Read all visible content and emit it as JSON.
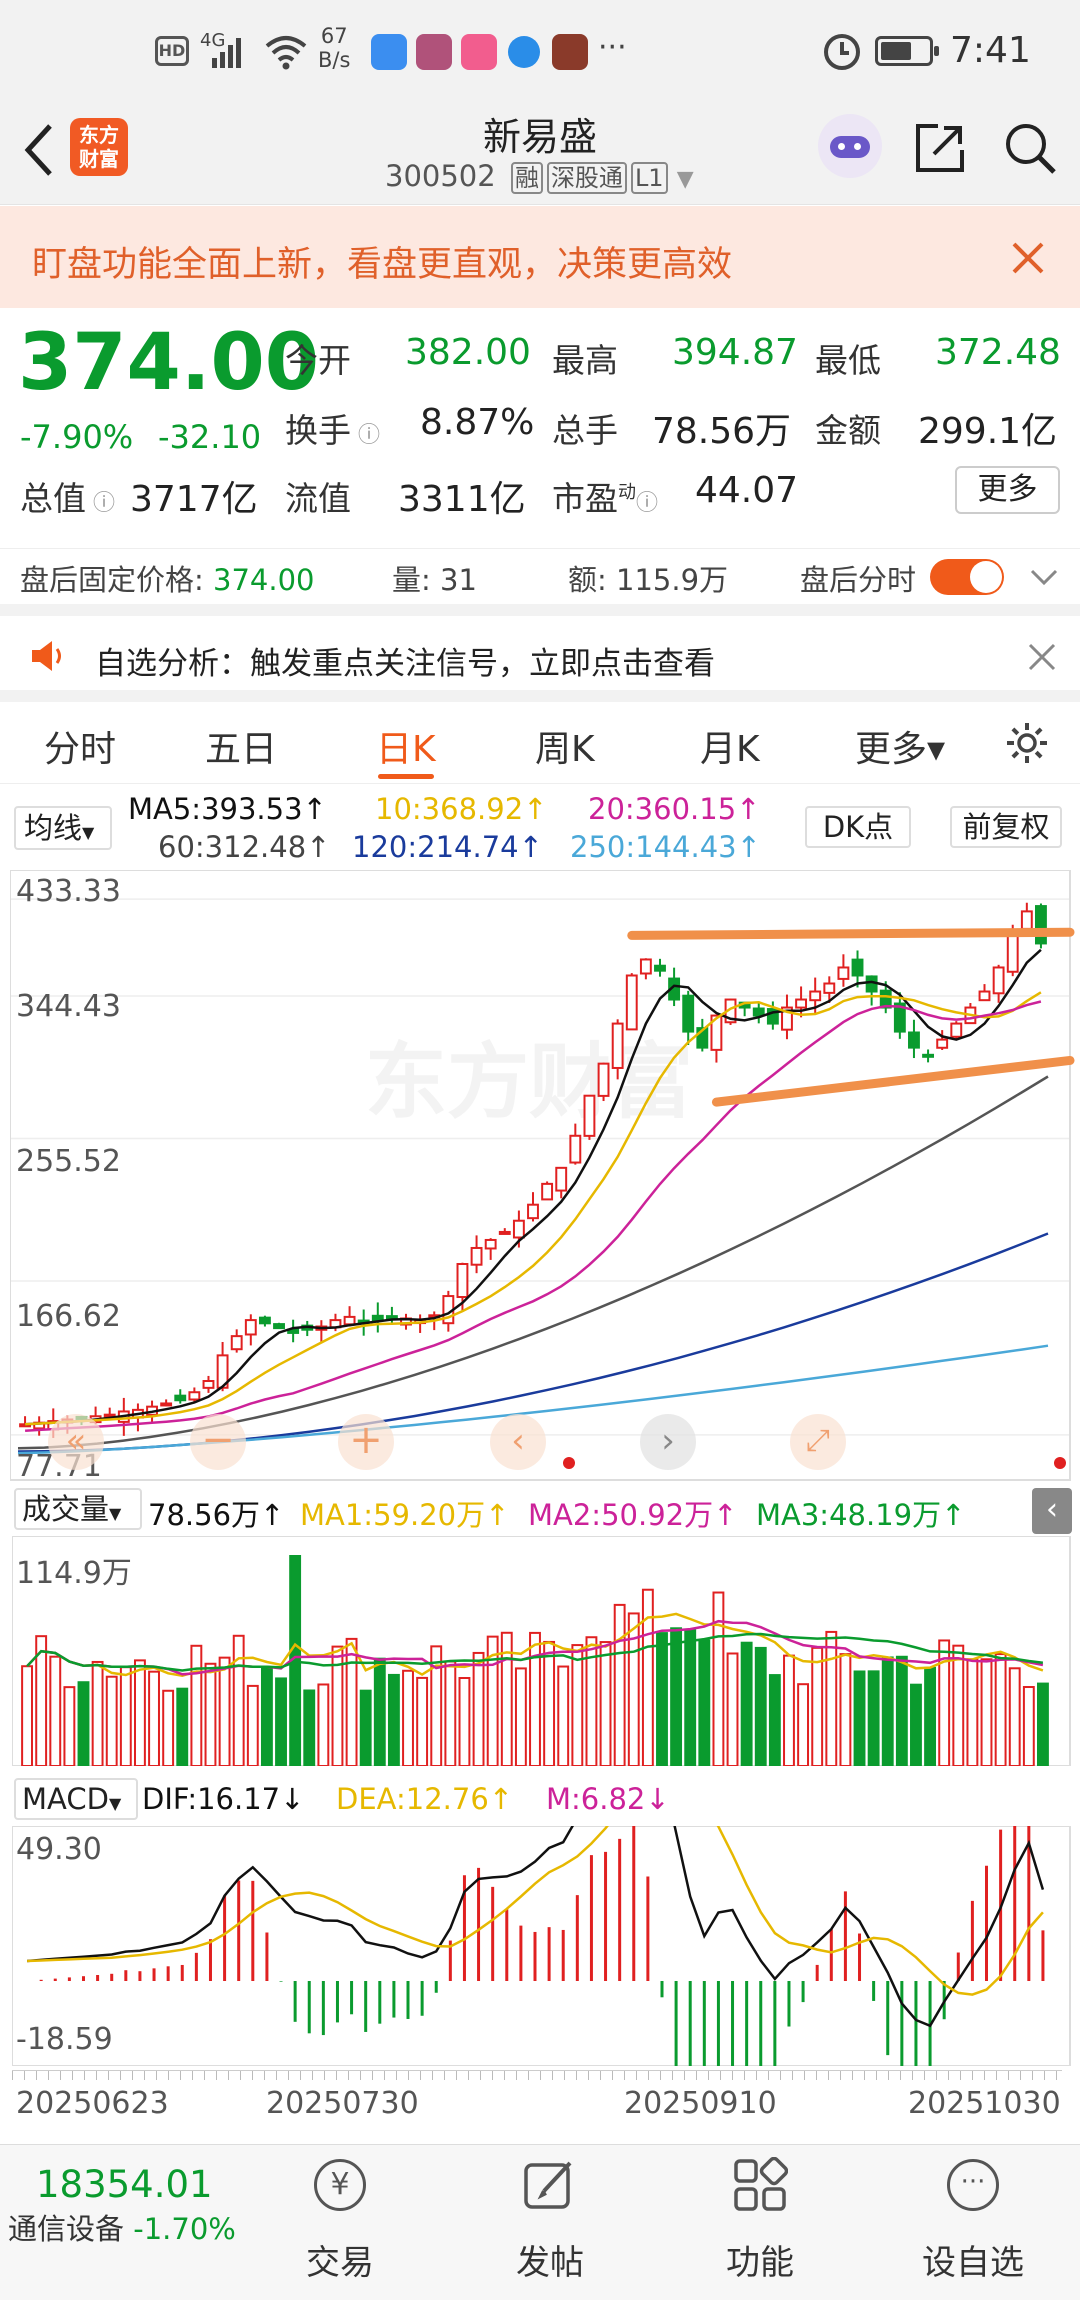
{
  "status_bar": {
    "signal": "4G",
    "net_speed_value": "67",
    "net_speed_unit": "B/s",
    "more": "···",
    "time": "7:41"
  },
  "header": {
    "logo_line1": "东方",
    "logo_line2": "财富",
    "stock_name": "新易盛",
    "stock_code": "300502",
    "tags": [
      "融",
      "深股通",
      "L1"
    ]
  },
  "banner": {
    "text": "盯盘功能全面上新，看盘更直观，决策更高效"
  },
  "quote": {
    "price": "374.00",
    "change_pct": "-7.90%",
    "change_amt": "-32.10",
    "open_label": "今开",
    "open": "382.00",
    "high_label": "最高",
    "high": "394.87",
    "low_label": "最低",
    "low": "372.48",
    "turnover_label": "换手",
    "turnover": "8.87%",
    "volume_label": "总手",
    "volume": "78.56万",
    "amount_label": "金额",
    "amount": "299.1亿",
    "mktcap_label": "总值",
    "mktcap": "3717亿",
    "float_label": "流值",
    "float_cap": "3311亿",
    "pe_label": "市盈",
    "pe_sup": "动",
    "pe": "44.07",
    "more_button": "更多"
  },
  "after_hours": {
    "price_label": "盘后固定价格:",
    "price": "374.00",
    "vol_label": "量:",
    "vol": "31",
    "amt_label": "额:",
    "amt": "115.9万",
    "toggle_label": "盘后分时"
  },
  "notice": {
    "text": "自选分析：触发重点关注信号，立即点击查看"
  },
  "tabs": {
    "items": [
      "分时",
      "五日",
      "日K",
      "周K",
      "月K",
      "更多▾"
    ],
    "active": "日K"
  },
  "ma_legend": {
    "selector": "均线",
    "ma5": "MA5:393.53↑",
    "ma10": "10:368.92↑",
    "ma20": "20:360.15↑",
    "ma60": "60:312.48↑",
    "ma120": "120:214.74↑",
    "ma250": "250:144.43↑",
    "dk_button": "DK点",
    "adjust_button": "前复权"
  },
  "colors": {
    "up": "#e02020",
    "down": "#0a9b2e",
    "ma5": "#111111",
    "ma10": "#e6b800",
    "ma20": "#cc2299",
    "ma60": "#555555",
    "ma120": "#1a3b9c",
    "ma250": "#4aa8d8",
    "trendline": "#f0904a",
    "accent": "#f05a1a"
  },
  "price_axis": [
    "433.33",
    "344.43",
    "255.52",
    "166.62",
    "77.71"
  ],
  "volume_legend": {
    "selector": "成交量",
    "vol": "78.56万↑",
    "ma1": "MA1:59.20万↑",
    "ma2": "MA2:50.92万↑",
    "ma3": "MA3:48.19万↑",
    "axis_max": "114.9万"
  },
  "macd_legend": {
    "selector": "MACD",
    "dif": "DIF:16.17↓",
    "dea": "DEA:12.76↑",
    "m": "M:6.82↓",
    "axis_max": "49.30",
    "axis_min": "-18.59"
  },
  "date_axis": [
    "20250623",
    "20250730",
    "20250910",
    "20251030"
  ],
  "watermark": "东方财富",
  "bottom_nav": {
    "index_value": "18354.01",
    "index_name": "通信设备",
    "index_change": "-1.70%",
    "items": [
      "交易",
      "发帖",
      "功能",
      "设自选"
    ]
  },
  "chart_data": {
    "type": "candlestick",
    "y_range": [
      77.71,
      433.33
    ],
    "closes": [
      95,
      96,
      97,
      98,
      99,
      100,
      101,
      103,
      104,
      106,
      108,
      110,
      115,
      122,
      138,
      150,
      160,
      158,
      155,
      152,
      154,
      156,
      160,
      162,
      158,
      160,
      162,
      161,
      160,
      163,
      175,
      195,
      205,
      210,
      215,
      222,
      232,
      245,
      255,
      275,
      300,
      320,
      345,
      375,
      385,
      378,
      360,
      340,
      330,
      350,
      360,
      355,
      350,
      345,
      355,
      360,
      365,
      370,
      380,
      375,
      365,
      355,
      340,
      330,
      325,
      335,
      345,
      355,
      365,
      380,
      400,
      415,
      395
    ]
  }
}
